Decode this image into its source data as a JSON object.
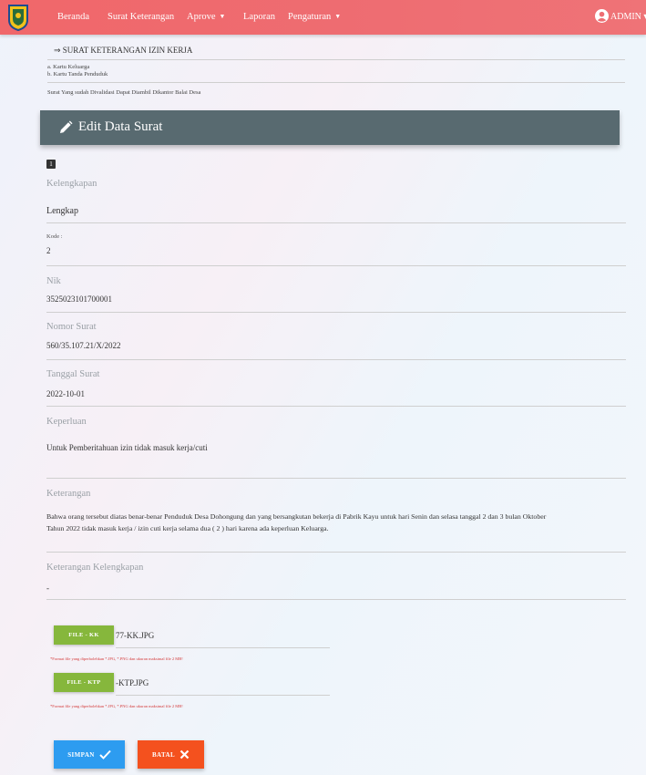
{
  "navbar": {
    "items": [
      {
        "label": "Beranda"
      },
      {
        "label": "Surat Keterangan"
      },
      {
        "label": "Aprove"
      },
      {
        "label": "Laporan"
      },
      {
        "label": "Pengaturan"
      }
    ],
    "admin_label": "ADMIN"
  },
  "letter": {
    "heading": "⇒ SURAT KETERANGAN IZIN KERJA",
    "requirements": [
      "a. Kartu Keluarga",
      "b. Kartu Tanda Penduduk"
    ],
    "note": "Surat Yang sudah Divalidasi Dapat Diambil Dikantor Balai Desa"
  },
  "edit_title": "Edit Data Surat",
  "badge": "1",
  "form": {
    "kelengkapan": {
      "label": "Kelengkapan",
      "value": "Lengkap"
    },
    "kode": {
      "label": "Kode :",
      "value": "2"
    },
    "nik": {
      "label": "Nik",
      "value": "3525023101700001"
    },
    "nomor_surat": {
      "label": "Nomor Surat",
      "value": "560/35.107.21/X/2022"
    },
    "tanggal_surat": {
      "label": "Tanggal Surat",
      "value": "2022-10-01"
    },
    "keperluan": {
      "label": "Keperluan",
      "value": "Untuk Pemberitahuan izin tidak masuk kerja/cuti"
    },
    "keterangan": {
      "label": "Keterangan",
      "line1": "Bahwa orang tersebut diatas benar-benar Penduduk Desa Dohongung dan yang bersangkutan bekerja di Pabrik Kayu untuk hari Senin dan selasa tanggal  2 dan 3 bulan  Oktober",
      "line2": "Tahun 2022  tidak  masuk kerja / izin cuti kerja selama dua ( 2 ) hari karena ada keperluan Keluarga."
    },
    "keterangan_kelengkapan": {
      "label": "Keterangan Kelengkapan",
      "value": "-"
    }
  },
  "files": {
    "kk": {
      "button": "FILE - KK",
      "filename": "77-KK.JPG"
    },
    "ktp": {
      "button": "FILE - KTP",
      "filename": "-KTP.JPG"
    },
    "hint": "*Format file yang diperbolehkan *.JPG, *.PNG dan ukuran maksimal file 2 MB!"
  },
  "actions": {
    "save": "SIMPAN",
    "cancel": "BATAL"
  },
  "colors": {
    "navbar": "#f0676a",
    "header": "#586a70",
    "file_button": "#86b73c",
    "save": "#2d9cf0",
    "cancel": "#f4511e",
    "hint": "#d43b3b"
  }
}
